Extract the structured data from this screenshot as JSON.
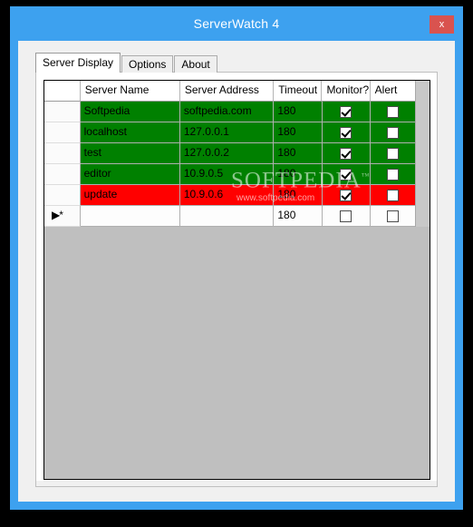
{
  "window": {
    "title": "ServerWatch 4",
    "close_label": "x",
    "chrome_color": "#3DA1EF",
    "close_color": "#D9534F"
  },
  "tabs": [
    {
      "label": "Server Display",
      "active": true
    },
    {
      "label": "Options",
      "active": false
    },
    {
      "label": "About",
      "active": false
    }
  ],
  "grid": {
    "columns": [
      "",
      "Server Name",
      "Server Address",
      "Timeout",
      "Monitor?",
      "Alert"
    ],
    "new_row_marker": "▶*",
    "status_colors": {
      "ok": "#008000",
      "alert": "#FF0000",
      "empty": "#FDFDFD"
    },
    "rows": [
      {
        "name": "Softpedia",
        "address": "softpedia.com",
        "timeout": "180",
        "monitor": true,
        "alert": false,
        "status": "ok"
      },
      {
        "name": "localhost",
        "address": "127.0.0.1",
        "timeout": "180",
        "monitor": true,
        "alert": false,
        "status": "ok"
      },
      {
        "name": "test",
        "address": "127.0.0.2",
        "timeout": "180",
        "monitor": true,
        "alert": false,
        "status": "ok"
      },
      {
        "name": "editor",
        "address": "10.9.0.5",
        "timeout": "180",
        "monitor": true,
        "alert": false,
        "status": "ok"
      },
      {
        "name": "update",
        "address": "10.9.0.6",
        "timeout": "180",
        "monitor": true,
        "alert": false,
        "status": "alert"
      },
      {
        "name": "",
        "address": "",
        "timeout": "180",
        "monitor": false,
        "alert": false,
        "status": "empty",
        "is_new": true
      }
    ]
  },
  "watermark": {
    "main": "SOFTPEDIA",
    "trademark": "™",
    "sub": "www.softpedia.com"
  }
}
